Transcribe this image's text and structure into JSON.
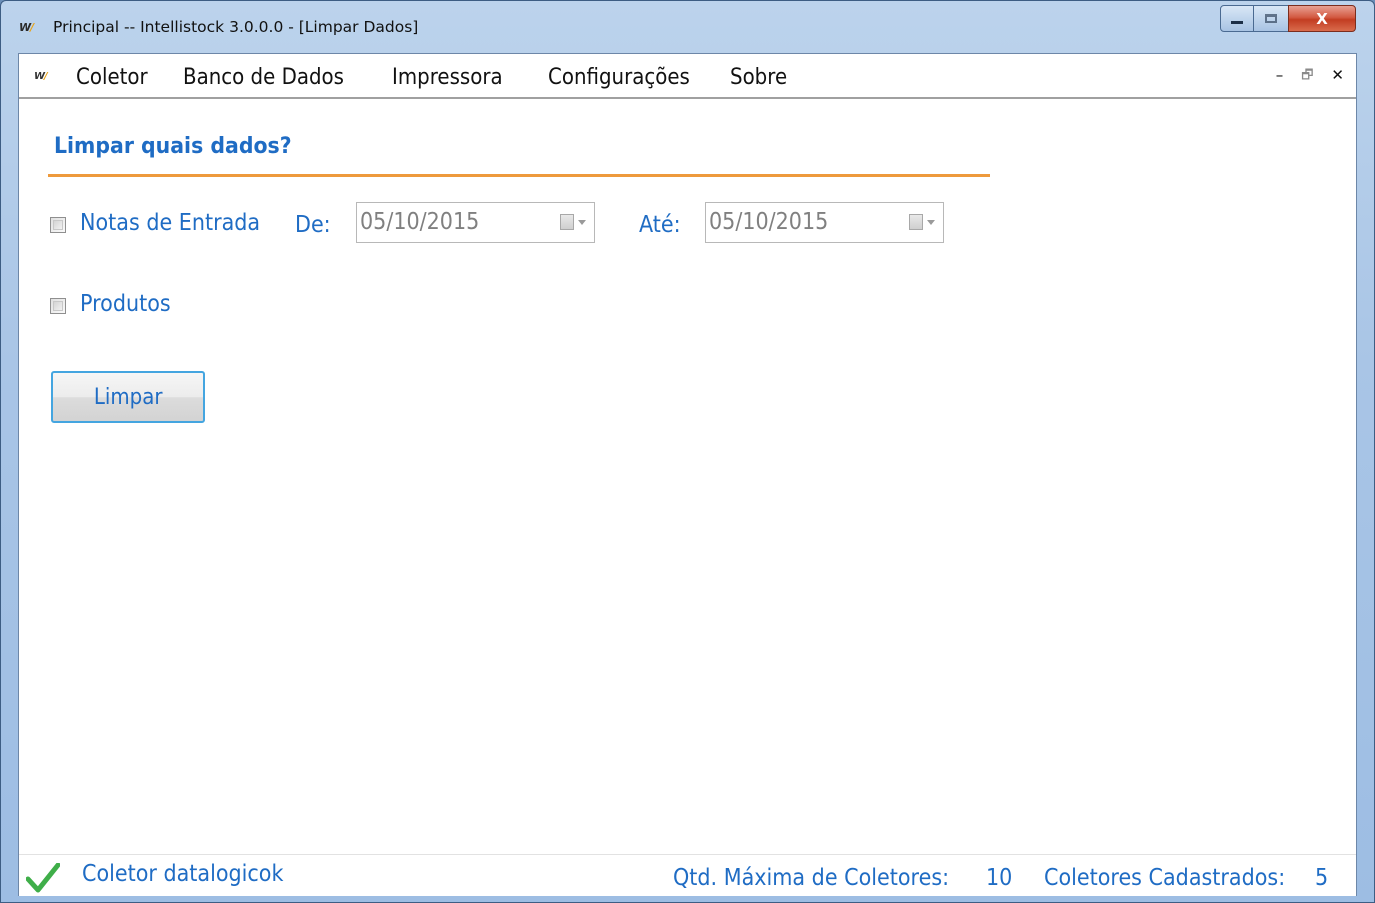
{
  "window": {
    "title": "Principal -- Intellistock 3.0.0.0 - [Limpar Dados]",
    "close_glyph": "X"
  },
  "menu": {
    "items": [
      "Coletor",
      "Banco de Dados",
      "Impressora",
      "Configurações",
      "Sobre"
    ],
    "mdi_minimize": "–",
    "mdi_restore": "🗗",
    "mdi_close": "✕"
  },
  "form": {
    "heading": "Limpar quais dados?",
    "notas": {
      "label": "Notas de Entrada",
      "checked": false
    },
    "de_label": "De:",
    "de_value": "05/10/2015",
    "ate_label": "Até:",
    "ate_value": "05/10/2015",
    "produtos": {
      "label": "Produtos",
      "checked": false
    },
    "limpar_button": "Limpar"
  },
  "status": {
    "collector": "Coletor datalogicok",
    "max_label": "Qtd. Máxima de Coletores:",
    "max_value": "10",
    "registered_label": "Coletores Cadastrados:",
    "registered_value": "5"
  },
  "colors": {
    "accent_blue": "#1f6cc4",
    "orange_rule": "#ee9a3c",
    "button_border": "#44a5e0",
    "check_green": "#3fae49"
  },
  "icons": [
    "app-logo-icon",
    "calendar-icon",
    "check-icon"
  ]
}
